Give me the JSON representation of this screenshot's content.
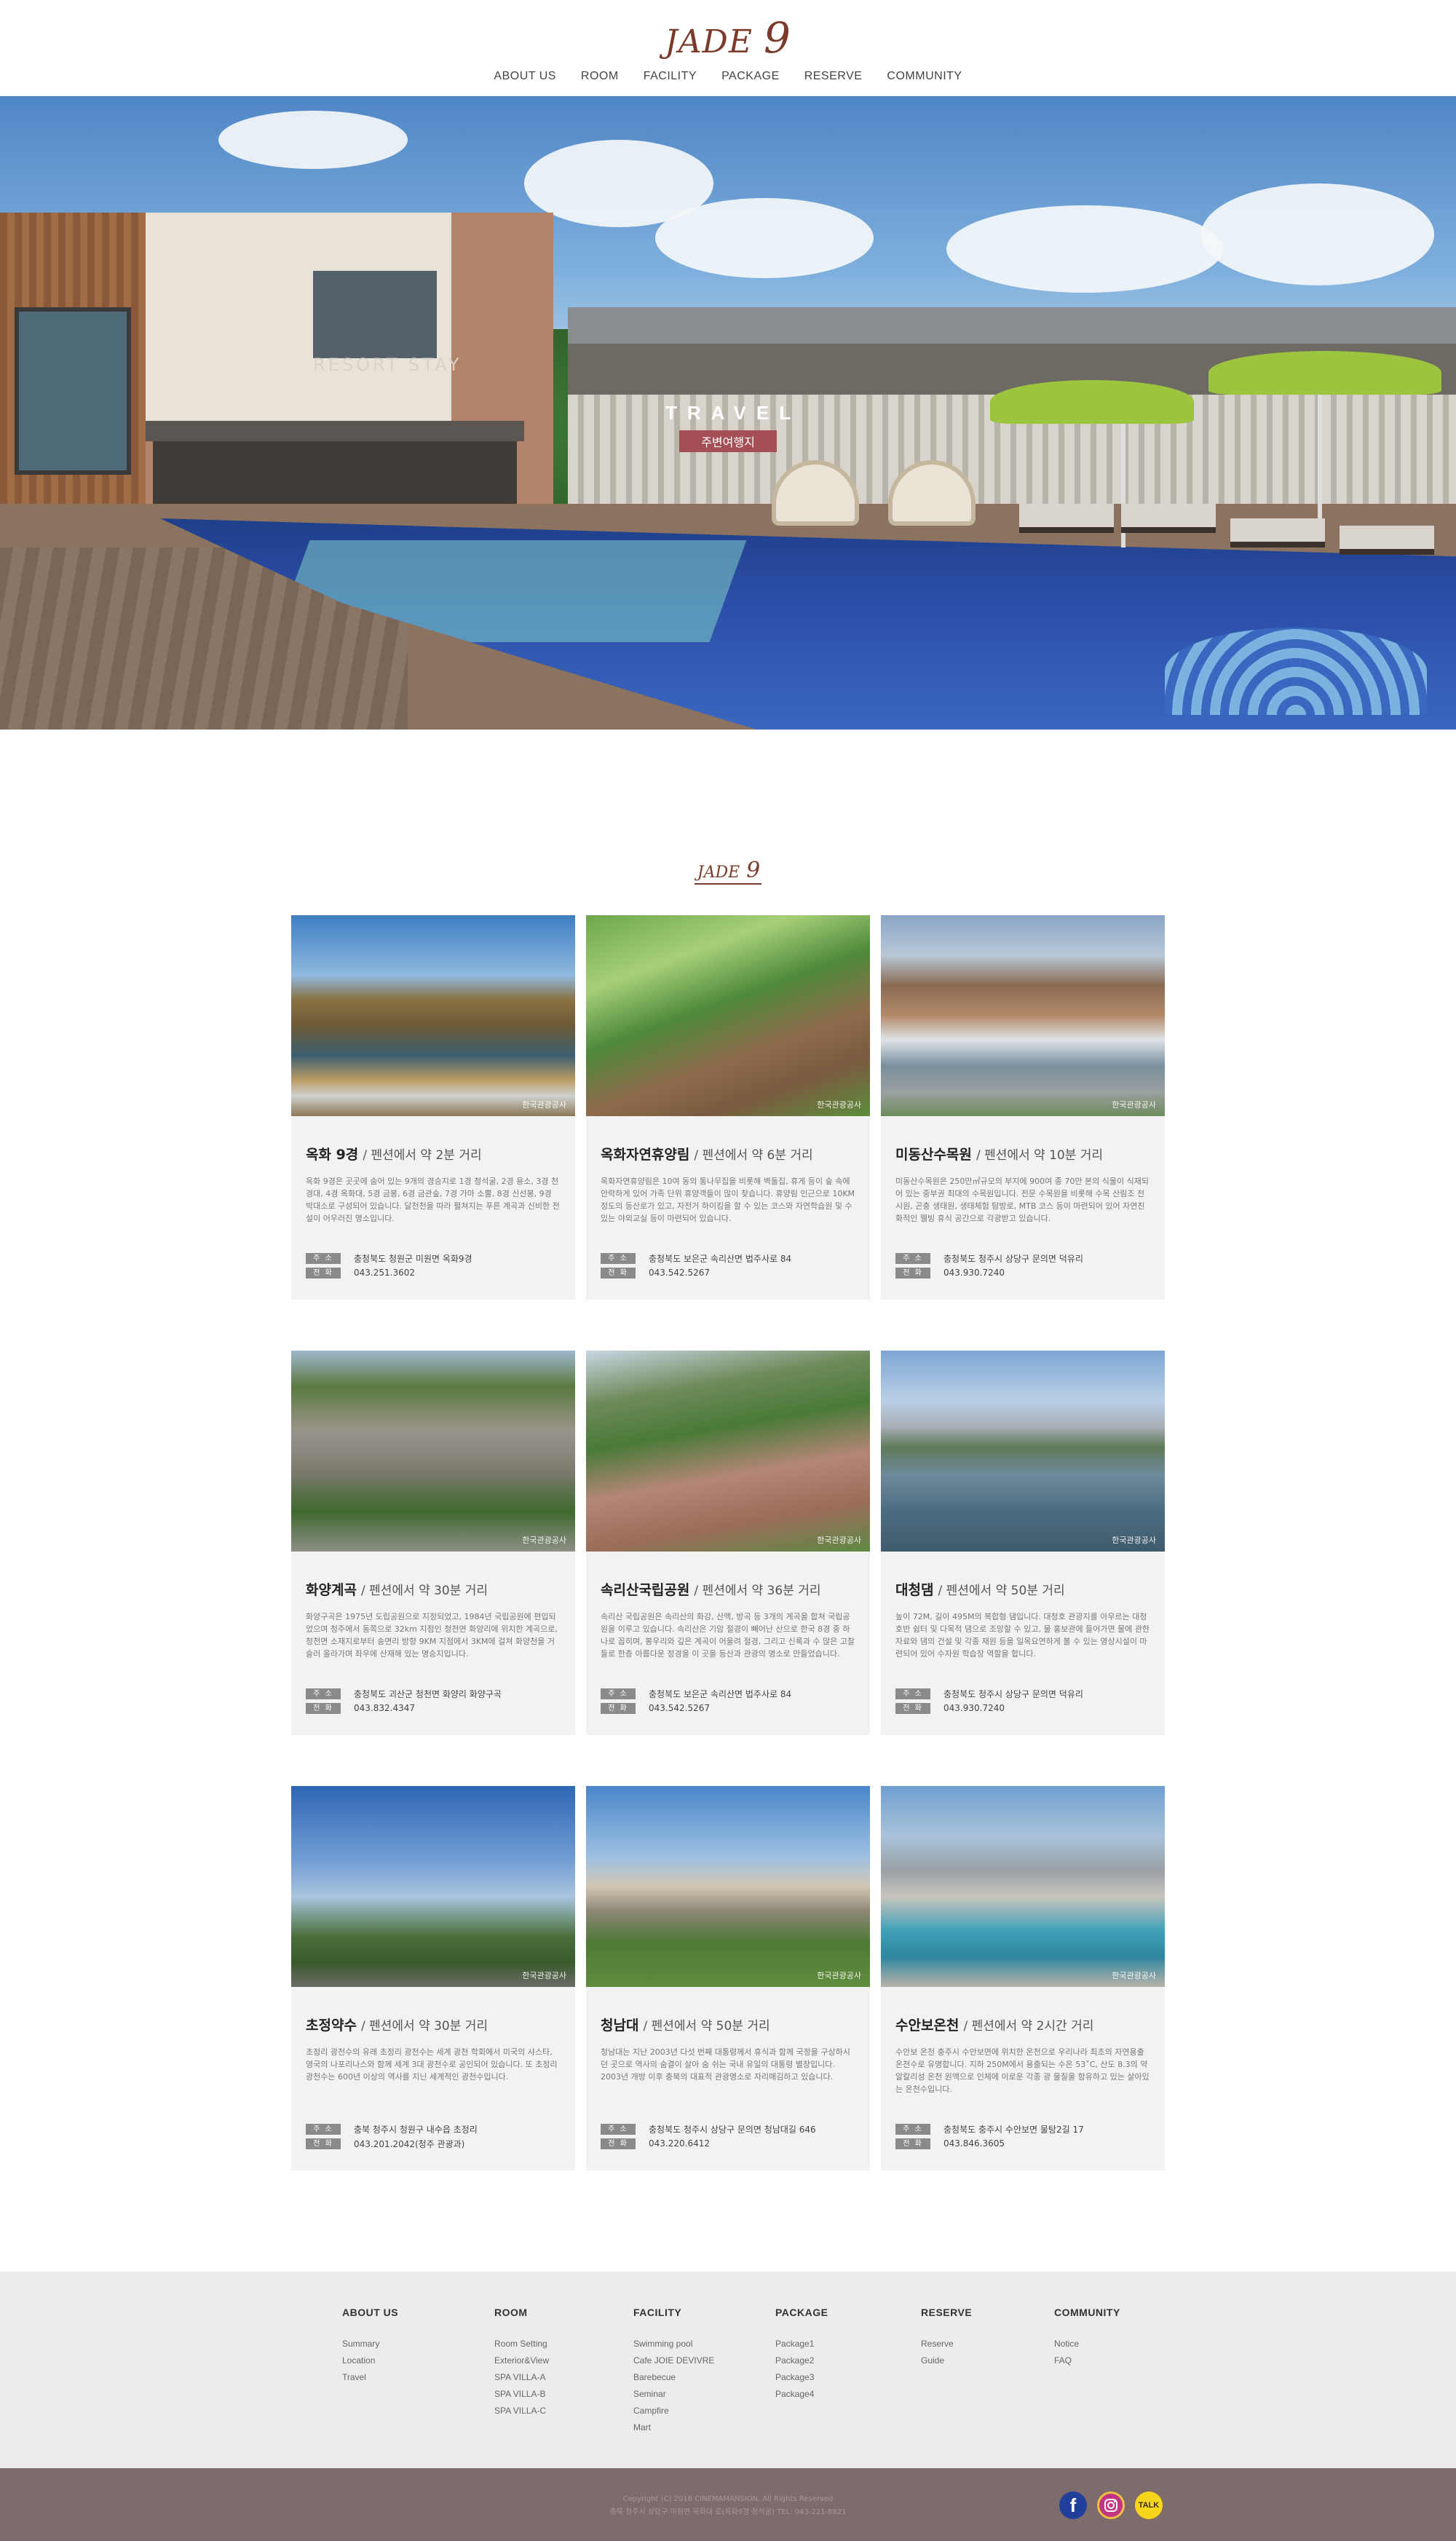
{
  "header": {
    "logo_text": "JADE",
    "logo_num": "9",
    "nav": [
      "ABOUT US",
      "ROOM",
      "FACILITY",
      "PACKAGE",
      "RESERVE",
      "COMMUNITY"
    ]
  },
  "hero": {
    "sign_text": "RESORT STAY",
    "title_en": "TRAVEL",
    "title_ko": "주변여행지"
  },
  "section": {
    "logo_text": "JADE",
    "logo_num": "9"
  },
  "labels": {
    "address": "주 소",
    "phone": "전 화"
  },
  "watermark": "한국관광공사",
  "cards": [
    {
      "name": "옥화 9경",
      "distance": "/ 펜션에서 약 2분 거리",
      "desc": "옥화 9경은 곳곳에 숨어 있는 9개의 경승지로 1경 청석굴, 2경 용소, 3경 천경대, 4경 옥화대, 5경 금봉, 6경 금관숲, 7경 가마 소뿔, 8경 신선봉, 9경 박대소로 구성되어 있습니다. 달천천을 따라 펼쳐지는 푸른 계곡과 신비한 전설이 어우러진 명소입니다.",
      "address": "충청북도 청원군 미원면 옥화9경",
      "phone": "043.251.3602"
    },
    {
      "name": "옥화자연휴양림",
      "distance": "/ 펜션에서 약 6분 거리",
      "desc": "옥화자연휴양림은 10여 동의 통나무집을 비롯해 벽돌집, 휴게 등이 숲 속에 안락하게 있어 가족 단위 휴양객들이 많이 찾습니다. 휴양림 인근으로 10KM 정도의 등산로가 있고, 자전거 하이킹을 할 수 있는 코스와 자연학습원 및 수 있는 야외교실 등이 마련되어 있습니다.",
      "address": "충청북도 보은군 속리산면 법주사로 84",
      "phone": "043.542.5267"
    },
    {
      "name": "미동산수목원",
      "distance": "/ 펜션에서 약 10분 거리",
      "desc": "미동산수목원은 250만㎡규모의 부지에 900여 종 70만 본의 식물이 식재되어 있는 중부권 최대의 수목원입니다. 전문 수목원을 비롯해 수목 산림조 전시원, 곤충 생태원, 생태체험 탐방로, MTB 코스 등이 마련되어 있어 자연친화적인 웰빙 휴식 공간으로 각광받고 있습니다.",
      "address": "충청북도 청주시 상당구 문의면 덕유리",
      "phone": "043.930.7240"
    },
    {
      "name": "화양계곡",
      "distance": "/ 펜션에서 약 30분 거리",
      "desc": "화양구곡은 1975년 도립공원으로 지정되었고, 1984년 국립공원에 편입되었으며 청주에서 동쪽으로 32km 지점인 청천면 화양리에 위치한 계곡으로, 청천면 소재지로부터 송면리 방향 9KM 지점에서 3KM에 걸쳐 화양천을 거슬러 올라가며 좌우에 산재해 있는 명승지입니다.",
      "address": "충청북도 괴산군 청천면 화양리 화양구곡",
      "phone": "043.832.4347"
    },
    {
      "name": "속리산국립공원",
      "distance": "/ 펜션에서 약 36분 거리",
      "desc": "속리산 국립공원은 속리산의 화강, 산맥, 방곡 등 3개의 계곡을 합쳐 국립공원을 이루고 있습니다. 속리산은 기암 절경이 빼어난 산으로 한국 8경 중 하나로 꼽히며, 봉우리와 깊은 계곡이 어울려 절경, 그리고 신록과 수 많은 고찰들로 한층 아름다운 정경을 이 곳을 등산과 관광의 명소로 만들었습니다.",
      "address": "충청북도 보은군 속리산면 법주사로 84",
      "phone": "043.542.5267"
    },
    {
      "name": "대청댐",
      "distance": "/ 펜션에서 약 50분 거리",
      "desc": "높이 72M, 길이 495M의 복합형 댐입니다. 대청호 관광지를 아우르는 대청호반 쉼터 및 다목적 댐으로 조망할 수 있고, 물 홍보관에 들어가면 물에 관한 자료와 댐의 건설 및 각종 재원 등을 일목요연하게 볼 수 있는 영상시설이 마련되어 있어 수자원 학습장 역할을 합니다.",
      "address": "충청북도 청주시 상당구 문의면 덕유리",
      "phone": "043.930.7240"
    },
    {
      "name": "초정약수",
      "distance": "/ 펜션에서 약 30분 거리",
      "desc": "초정리 광천수의 유래 초정리 광천수는 세계 광천 학회에서 미국의 샤스타, 영국의 나포리나스와 함께 세계 3대 광천수로 공인되어 있습니다. 또 초정리 광천수는 600년 이상의 역사를 지닌 세계적인 광천수입니다.",
      "address": "충북 청주시 청원구 내수읍 초정리",
      "phone": "043.201.2042(청주 관광과)"
    },
    {
      "name": "청남대",
      "distance": "/ 펜션에서 약 50분 거리",
      "desc": "청남대는 지난 2003년 다섯 번째 대통령께서 휴식과 함께 국정을 구상하시던 곳으로 역사의 숨결이 살아 숨 쉬는 국내 유일의 대통령 별장입니다. 2003년 개방 이후 충북의 대표적 관광명소로 자리매김하고 있습니다.",
      "address": "충청북도 청주시 상당구 문의면 청남대길 646",
      "phone": "043.220.6412"
    },
    {
      "name": "수안보온천",
      "distance": "/ 펜션에서 약 2시간 거리",
      "desc": "수안보 온천 충주시 수안보면에 위치한 온천으로 우리나라 최초의 자연용출 온천수로 유명합니다. 지하 250M에서 용출되는 수온 53˚C, 산도 8.3의 약 알칼리성 온천 원액으로 인체에 이로운 각종 광 물질을 함유하고 있는 살아있는 온천수입니다.",
      "address": "충청북도 충주시 수안보면 물탕2길 17",
      "phone": "043.846.3605"
    }
  ],
  "footer": {
    "columns": [
      {
        "head": "ABOUT US",
        "links": [
          "Summary",
          "Location",
          "Travel"
        ]
      },
      {
        "head": "ROOM",
        "links": [
          "Room Setting",
          "Exterior&View",
          "SPA VILLA-A",
          "SPA VILLA-B",
          "SPA VILLA-C"
        ]
      },
      {
        "head": "FACILITY",
        "links": [
          "Swimming pool",
          "Cafe JOIE DEVIVRE",
          "Barebecue",
          "Seminar",
          "Campfire",
          "Mart"
        ]
      },
      {
        "head": "PACKAGE",
        "links": [
          "Package1",
          "Package2",
          "Package3",
          "Package4"
        ]
      },
      {
        "head": "RESERVE",
        "links": [
          "Reserve",
          "Guide"
        ]
      },
      {
        "head": "COMMUNITY",
        "links": [
          "Notice",
          "FAQ"
        ]
      }
    ],
    "copyright": "Copyright (C) 2016 CINEMAMANSION. All Rights Reserved",
    "address_line": "충북 청주시 상당구 미원면 옥화대 로(옥화9경 청석굴) TEL: 043-221-8821",
    "sns": [
      "facebook-icon",
      "instagram-icon",
      "kakaotalk-icon"
    ],
    "talk_label": "TALK"
  },
  "colors": {
    "brand": "#7a3b2a",
    "travel_badge": "#a34f55",
    "footer_bar": "#7e6c6c",
    "card_bg": "#f2f2f2"
  }
}
